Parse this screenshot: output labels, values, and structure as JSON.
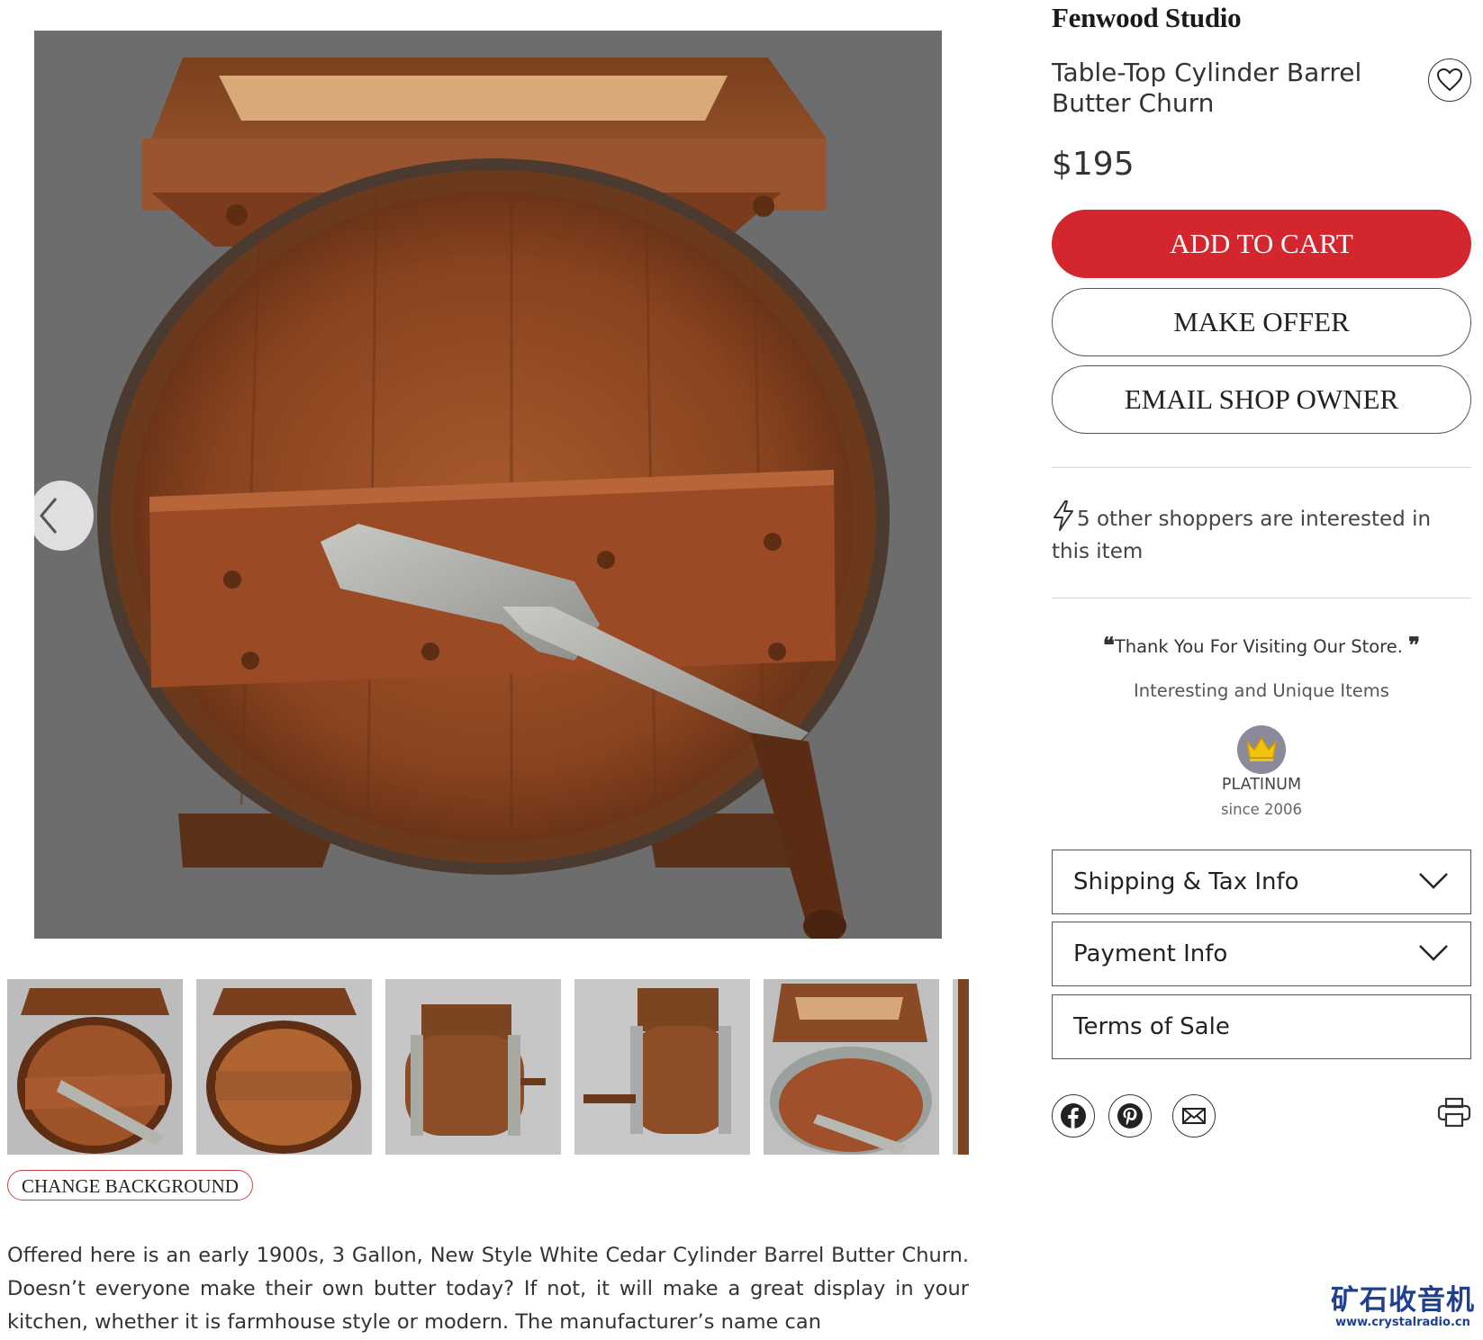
{
  "shop": {
    "name": "Fenwood Studio"
  },
  "product": {
    "title": "Table-Top Cylinder Barrel Butter Churn",
    "price": "$195",
    "description": "Offered here is an early 1900s, 3 Gallon, New Style White Cedar Cylinder Barrel Butter Churn. Doesn’t everyone make their own butter today? If not, it will make a great display in your kitchen, whether it is farmhouse style or modern. The manufacturer’s name can"
  },
  "actions": {
    "add_to_cart": "ADD TO CART",
    "make_offer": "MAKE OFFER",
    "email_owner": "EMAIL SHOP OWNER",
    "change_background": "CHANGE BACKGROUND"
  },
  "interest": {
    "text": "5 other shoppers are interested in this item"
  },
  "store_message": {
    "open_quote": "❝",
    "quote": "Thank You For Visiting Our Store.",
    "close_quote": "❞",
    "tagline": "Interesting and Unique Items"
  },
  "badge": {
    "level": "PLATINUM",
    "since": "since 2006",
    "icon": "crown-icon"
  },
  "accordions": [
    {
      "label": "Shipping & Tax Info",
      "expandable": true
    },
    {
      "label": "Payment Info",
      "expandable": true
    },
    {
      "label": "Terms of Sale",
      "expandable": false
    }
  ],
  "share_icons": [
    "facebook-icon",
    "pinterest-icon",
    "email-icon",
    "print-icon"
  ],
  "gallery": {
    "thumbnail_count": 6,
    "selected_index": 0
  },
  "watermark": {
    "line1": "矿石收音机",
    "line2": "www.crystalradio.cn"
  },
  "colors": {
    "accent": "#d4262f",
    "photo_background": "#6d6d6d",
    "watermark": "#1f3f8f"
  }
}
